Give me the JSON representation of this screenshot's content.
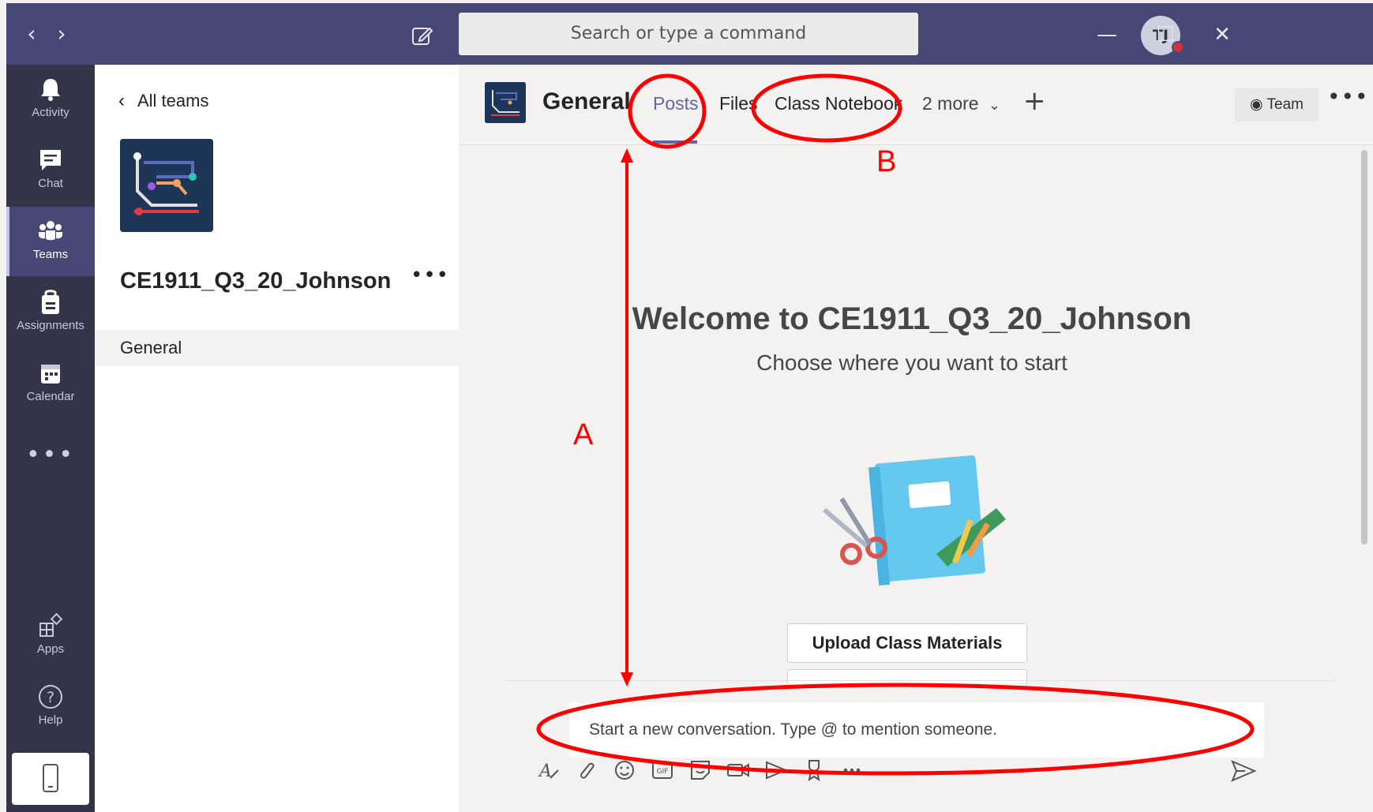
{
  "titlebar": {
    "search_placeholder": "Search or type a command",
    "avatar_initials": "TJ",
    "accent": "#464775"
  },
  "rail": {
    "items": [
      {
        "label": "Activity",
        "icon": "bell-icon"
      },
      {
        "label": "Chat",
        "icon": "chat-icon"
      },
      {
        "label": "Teams",
        "icon": "teams-icon"
      },
      {
        "label": "Assignments",
        "icon": "assignments-icon"
      },
      {
        "label": "Calendar",
        "icon": "calendar-icon"
      },
      {
        "label": "Apps",
        "icon": "apps-icon"
      },
      {
        "label": "Help",
        "icon": "help-icon"
      }
    ],
    "more": "•••"
  },
  "team_panel": {
    "back_label": "All teams",
    "team_name": "CE1911_Q3_20_Johnson",
    "more": "•••",
    "channels": [
      {
        "label": "General"
      }
    ]
  },
  "channel_header": {
    "title": "General",
    "tabs": [
      {
        "label": "Posts"
      },
      {
        "label": "Files"
      },
      {
        "label": "Class Notebook"
      },
      {
        "label": "2 more"
      }
    ],
    "team_button": "Team",
    "more": "•••"
  },
  "welcome": {
    "title": "Welcome to CE1911_Q3_20_Johnson",
    "subtitle": "Choose where you want to start",
    "cta": "Upload Class Materials"
  },
  "compose": {
    "placeholder": "Start a new conversation. Type @ to mention someone."
  },
  "annotations": {
    "a": "A",
    "b": "B",
    "color": "#ff0000"
  }
}
